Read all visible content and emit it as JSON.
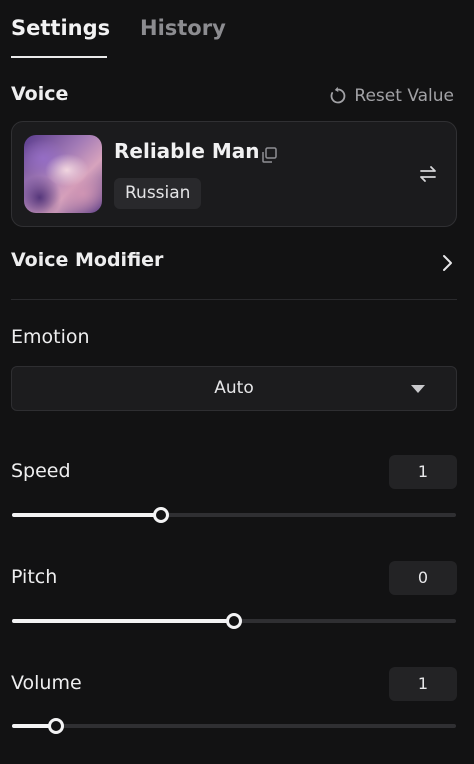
{
  "tabs": [
    {
      "label": "Settings",
      "active": true
    },
    {
      "label": "History",
      "active": false
    }
  ],
  "voice": {
    "section_label": "Voice",
    "reset_label": "Reset Value",
    "name": "Reliable Man",
    "language": "Russian"
  },
  "modifier": {
    "label": "Voice Modifier"
  },
  "emotion": {
    "label": "Emotion",
    "value": "Auto"
  },
  "sliders": {
    "speed": {
      "label": "Speed",
      "value": "1",
      "fill_fraction": 0.335
    },
    "pitch": {
      "label": "Pitch",
      "value": "0",
      "fill_fraction": 0.5
    },
    "volume": {
      "label": "Volume",
      "value": "1",
      "fill_fraction": 0.1
    }
  },
  "icons": [
    "reset-icon",
    "copy-icon",
    "swap-icon",
    "chevron-right-icon",
    "caret-down-icon"
  ],
  "colors": {
    "background": "#121213",
    "card": "#1b1b1d",
    "accent": "#f3f3f4"
  }
}
